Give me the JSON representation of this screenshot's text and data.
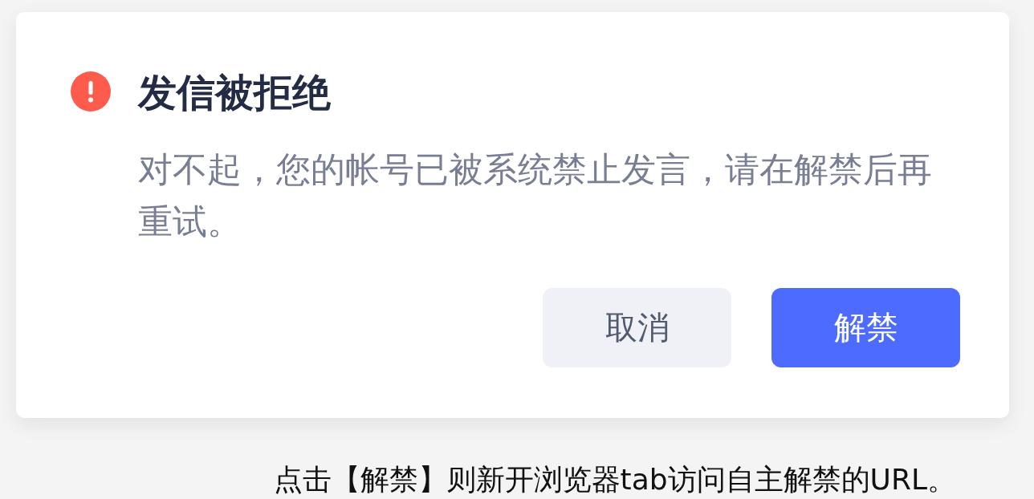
{
  "dialog": {
    "kind": "error",
    "title": "发信被拒绝",
    "message": "对不起，您的帐号已被系统禁止发言，请在解禁后再重试。",
    "buttons": [
      {
        "label": "取消",
        "kind": "secondary"
      },
      {
        "label": "解禁",
        "kind": "primary"
      }
    ]
  },
  "caption": "点击【解禁】则新开浏览器tab访问自主解禁的URL。"
}
